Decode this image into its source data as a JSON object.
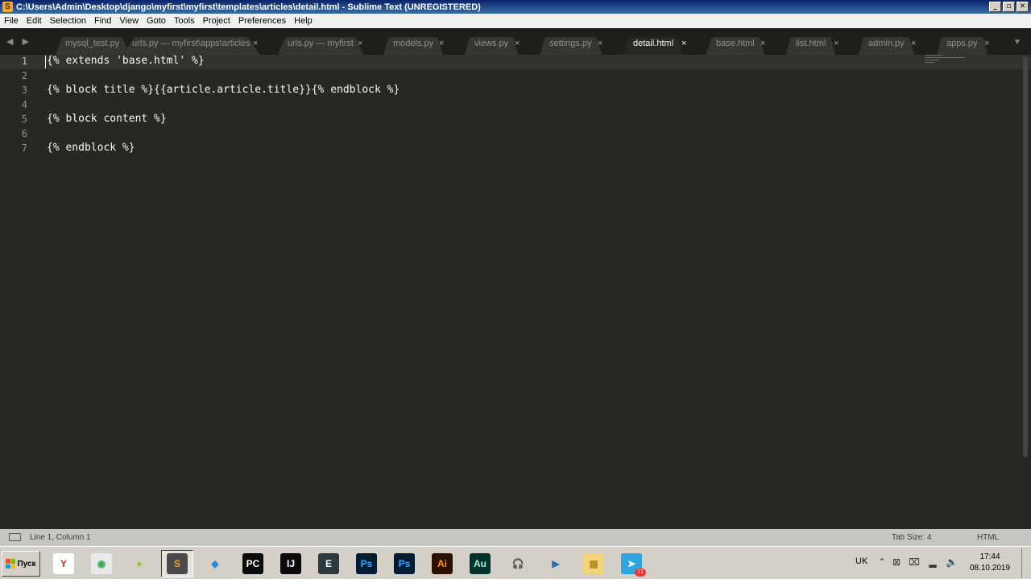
{
  "window": {
    "title": "C:\\Users\\Admin\\Desktop\\django\\myfirst\\myfirst\\templates\\articles\\detail.html - Sublime Text (UNREGISTERED)",
    "app_icon_glyph": "S",
    "controls": {
      "minimize": "_",
      "maximize": "▫",
      "close": "✕"
    }
  },
  "menu": [
    "File",
    "Edit",
    "Selection",
    "Find",
    "View",
    "Goto",
    "Tools",
    "Project",
    "Preferences",
    "Help"
  ],
  "tabs": {
    "nav_arrows": "◀ ▶",
    "overflow": "▼",
    "close_glyph": "×",
    "items": [
      {
        "label": "mysql_test.py",
        "active": false
      },
      {
        "label": "urls.py — myfirst\\apps\\articles",
        "active": false
      },
      {
        "label": "urls.py — myfirst",
        "active": false
      },
      {
        "label": "models.py",
        "active": false
      },
      {
        "label": "views.py",
        "active": false
      },
      {
        "label": "settings.py",
        "active": false
      },
      {
        "label": "detail.html",
        "active": true
      },
      {
        "label": "base.html",
        "active": false
      },
      {
        "label": "list.html",
        "active": false
      },
      {
        "label": "admin.py",
        "active": false
      },
      {
        "label": "apps.py",
        "active": false
      }
    ]
  },
  "editor": {
    "current_line": 1,
    "lines": [
      "{% extends 'base.html' %}",
      "",
      "{% block title %}{{article.article.title}}{% endblock %}",
      "",
      "{% block content %}",
      "",
      "{% endblock %}"
    ]
  },
  "status": {
    "position": "Line 1, Column 1",
    "tab_size": "Tab Size: 4",
    "syntax": "HTML"
  },
  "taskbar": {
    "start_label": "Пуск",
    "apps": [
      {
        "name": "yandex-browser",
        "glyph": "Y",
        "bg": "#ffffff",
        "fg": "#e52620"
      },
      {
        "name": "chrome",
        "glyph": "◉",
        "bg": "#e9e9e9",
        "fg": "#34a853"
      },
      {
        "name": "lime",
        "glyph": "●",
        "bg": "#d4d0c8",
        "fg": "#9bc23c"
      },
      {
        "name": "sublime-text",
        "glyph": "S",
        "bg": "#4b4b4b",
        "fg": "#f59b21",
        "active": true
      },
      {
        "name": "vscode",
        "glyph": "◆",
        "bg": "#d4d0c8",
        "fg": "#2a8ad8"
      },
      {
        "name": "pycharm",
        "glyph": "PC",
        "bg": "#0b0b0b",
        "fg": "#ffffff"
      },
      {
        "name": "intellij",
        "glyph": "IJ",
        "bg": "#0b0b0b",
        "fg": "#ffffff"
      },
      {
        "name": "editor-app",
        "glyph": "E",
        "bg": "#2b3a3e",
        "fg": "#ffffff"
      },
      {
        "name": "photoshop-a",
        "glyph": "Ps",
        "bg": "#001d34",
        "fg": "#31a8ff"
      },
      {
        "name": "photoshop-b",
        "glyph": "Ps",
        "bg": "#001d34",
        "fg": "#31a8ff"
      },
      {
        "name": "illustrator",
        "glyph": "Ai",
        "bg": "#2d0f00",
        "fg": "#ff9a00"
      },
      {
        "name": "audition",
        "glyph": "Au",
        "bg": "#00332b",
        "fg": "#9ff0d4"
      },
      {
        "name": "audio-app",
        "glyph": "🎧",
        "bg": "#d4d0c8",
        "fg": "#6b2ea6"
      },
      {
        "name": "media-player",
        "glyph": "▶",
        "bg": "#d4d0c8",
        "fg": "#2a6fb8"
      },
      {
        "name": "file-explorer",
        "glyph": "▦",
        "bg": "#f3d47a",
        "fg": "#b88a1f"
      },
      {
        "name": "telegram",
        "glyph": "➤",
        "bg": "#2ca5e0",
        "fg": "#ffffff"
      }
    ],
    "telegram_badge": "71",
    "language": "UK",
    "time": "17:44",
    "date": "08.10.2019"
  },
  "colors": {
    "editor_bg": "#272822",
    "tabbar_bg": "#1e1f1b",
    "status_bg": "#c6c7c3",
    "text": "#f8f8f2"
  }
}
